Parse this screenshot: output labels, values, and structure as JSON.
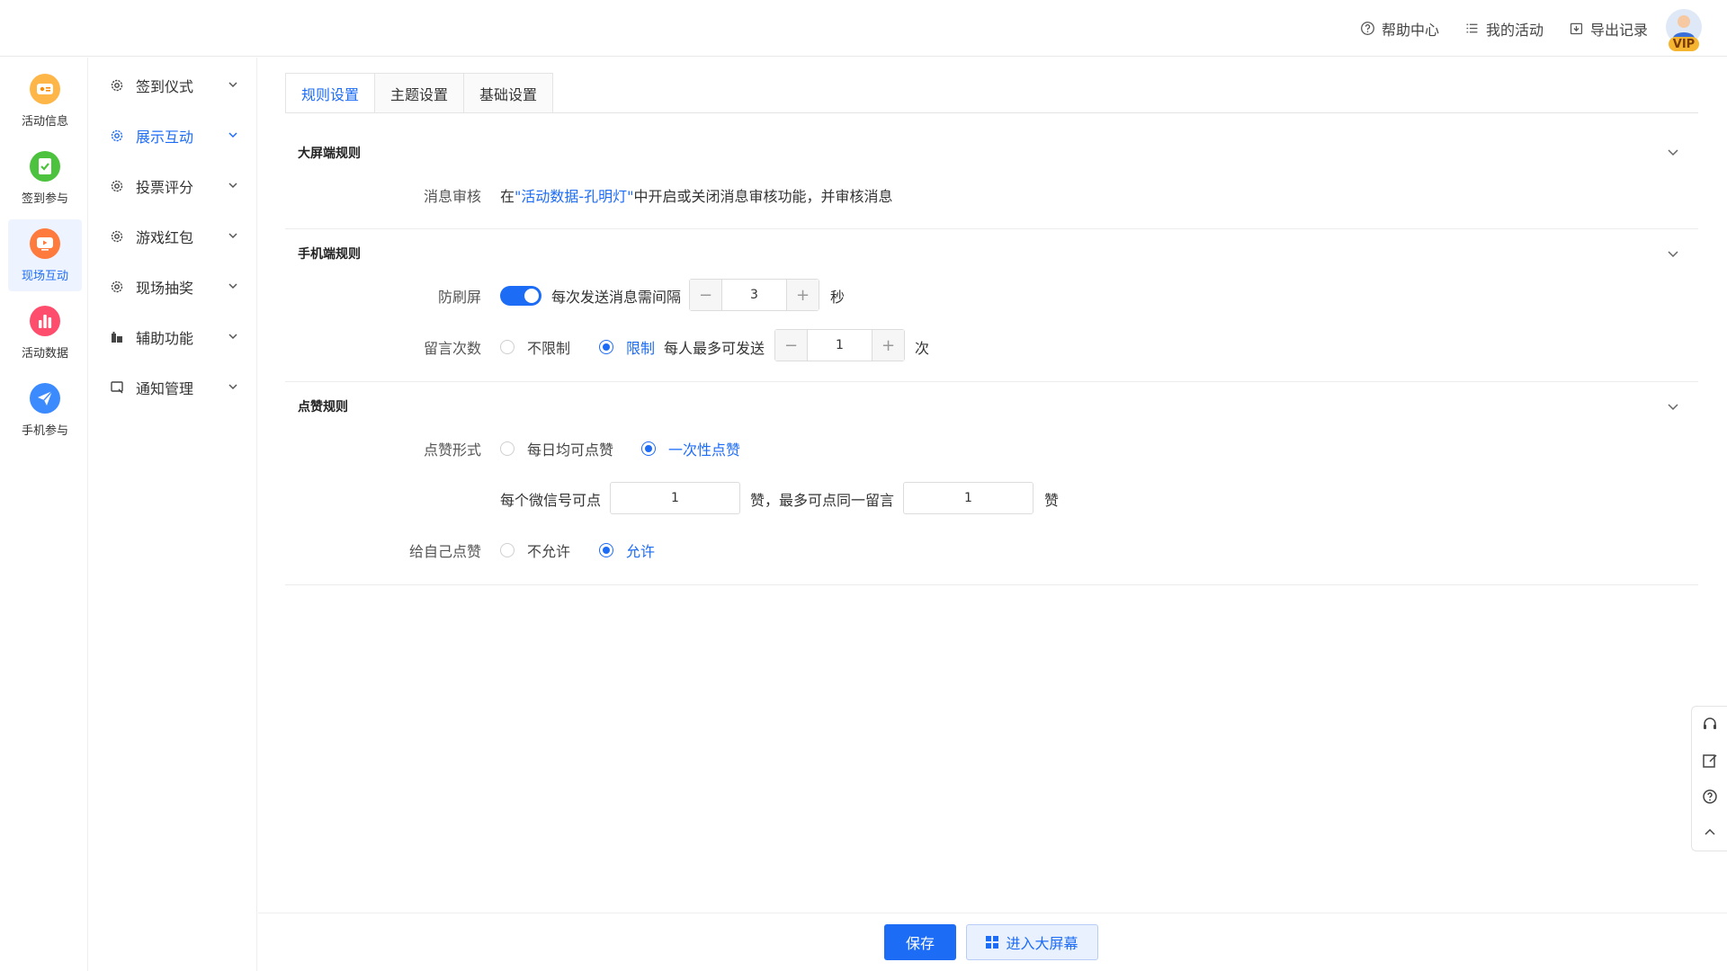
{
  "topnav": {
    "help": "帮助中心",
    "activities": "我的活动",
    "export": "导出记录",
    "vip": "VIP"
  },
  "rail": {
    "items": [
      {
        "label": "活动信息",
        "icon": "activity-info-icon",
        "color": "#f5a623"
      },
      {
        "label": "签到参与",
        "icon": "checkin-icon",
        "color": "#52c41a"
      },
      {
        "label": "现场互动",
        "icon": "live-interaction-icon",
        "color": "#ff7a3d"
      },
      {
        "label": "活动数据",
        "icon": "data-chart-icon",
        "color": "#ff4d6d"
      },
      {
        "label": "手机参与",
        "icon": "paper-plane-icon",
        "color": "#3b8bff"
      }
    ]
  },
  "submenu": {
    "items": [
      {
        "label": "签到仪式",
        "icon": "gear-icon"
      },
      {
        "label": "展示互动",
        "icon": "gear-icon"
      },
      {
        "label": "投票评分",
        "icon": "gear-icon"
      },
      {
        "label": "游戏红包",
        "icon": "gear-icon"
      },
      {
        "label": "现场抽奖",
        "icon": "gear-icon"
      },
      {
        "label": "辅助功能",
        "icon": "building-icon"
      },
      {
        "label": "通知管理",
        "icon": "notice-icon"
      }
    ]
  },
  "tabs": [
    "规则设置",
    "主题设置",
    "基础设置"
  ],
  "big_screen": {
    "title": "大屏端规则",
    "review_label": "消息审核",
    "review_prefix": "在",
    "review_link": "\"活动数据-孔明灯\"",
    "review_suffix": "中开启或关闭消息审核功能，并审核消息"
  },
  "mobile": {
    "title": "手机端规则",
    "antispam_label": "防刷屏",
    "interval_text": "每次发送消息需间隔",
    "interval_value": "3",
    "interval_unit": "秒",
    "msg_count_label": "留言次数",
    "unlimited": "不限制",
    "limited": "限制",
    "per_person_text": "每人最多可发送",
    "per_person_value": "1",
    "per_person_unit": "次"
  },
  "like": {
    "title": "点赞规则",
    "form_label": "点赞形式",
    "daily": "每日均可点赞",
    "once": "一次性点赞",
    "per_wechat_text": "每个微信号可点",
    "per_wechat_value": "1",
    "mid_text": "赞，最多可点同一留言",
    "same_msg_value": "1",
    "end_unit": "赞",
    "self_label": "给自己点赞",
    "disallow": "不允许",
    "allow": "允许"
  },
  "bottom": {
    "save": "保存",
    "enter_screen": "进入大屏幕"
  },
  "colors": {
    "primary": "#1d6cf5"
  }
}
